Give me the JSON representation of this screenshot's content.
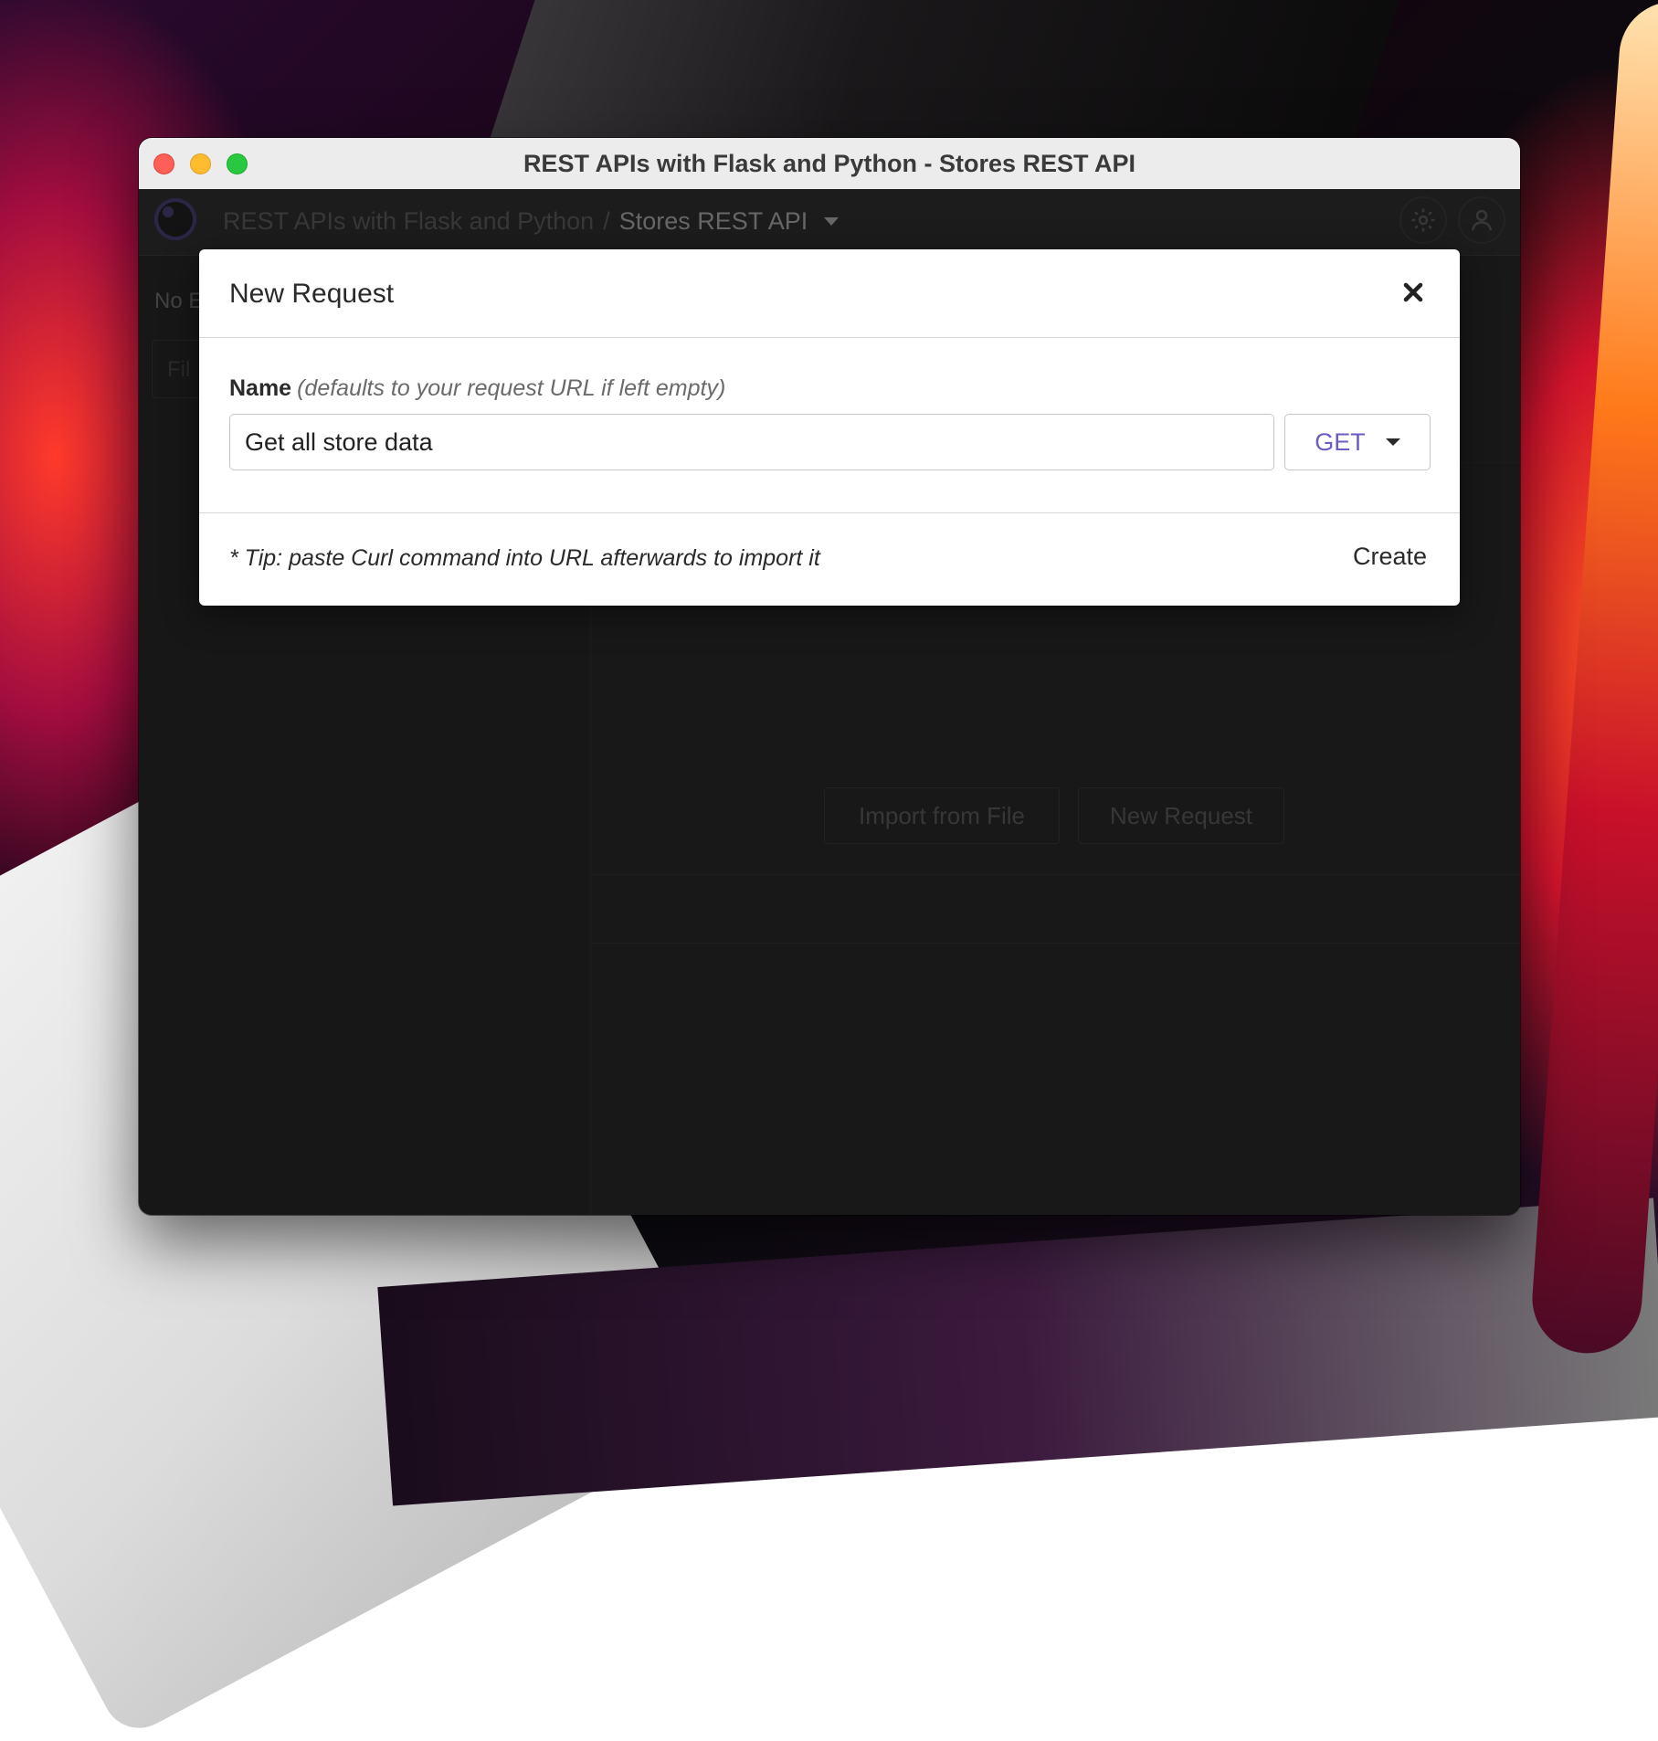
{
  "window": {
    "title": "REST APIs with Flask and Python - Stores REST API"
  },
  "header": {
    "workspace": "REST APIs with Flask and Python",
    "separator": "/",
    "collection": "Stores REST API",
    "icons": [
      "settings-gear-icon",
      "account-icon"
    ]
  },
  "sidebar": {
    "environment_label": "No E",
    "filter_placeholder": "Fil"
  },
  "main": {
    "import_button": "Import from File",
    "new_request_button": "New Request"
  },
  "modal": {
    "title": "New Request",
    "name_label": "Name",
    "name_hint": "(defaults to your request URL if left empty)",
    "name_value": "Get all store data",
    "method": "GET",
    "tip": "* Tip: paste Curl command into URL afterwards to import it",
    "create_label": "Create"
  },
  "colors": {
    "method_accent": "#6b5bc4",
    "app_background": "#1f1f1f",
    "close_red": "#fe5f57",
    "minimize_yellow": "#febc2e",
    "maximize_green": "#28c840"
  }
}
